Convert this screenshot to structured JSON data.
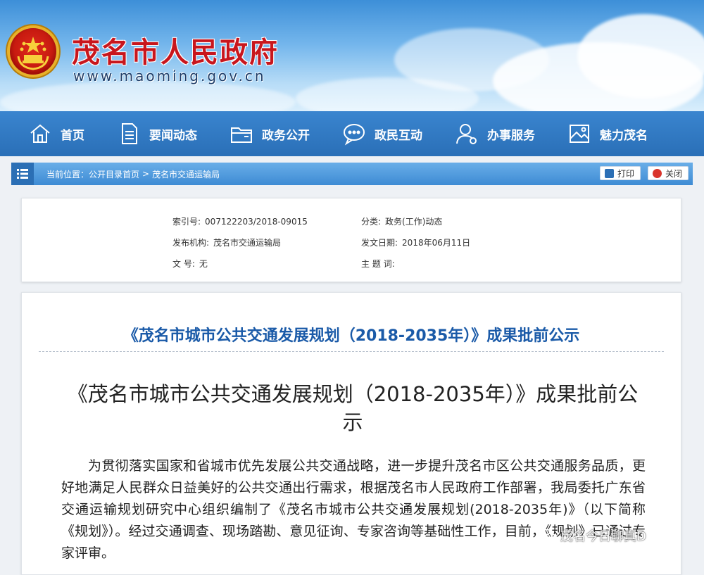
{
  "site": {
    "title": "茂名市人民政府",
    "url": "www.maoming.gov.cn"
  },
  "nav": {
    "items": [
      {
        "label": "首页",
        "icon": "home-icon"
      },
      {
        "label": "要闻动态",
        "icon": "document-icon"
      },
      {
        "label": "政务公开",
        "icon": "folder-icon"
      },
      {
        "label": "政民互动",
        "icon": "chat-icon"
      },
      {
        "label": "办事服务",
        "icon": "user-service-icon"
      },
      {
        "label": "魅力茂名",
        "icon": "landscape-icon"
      }
    ]
  },
  "location": {
    "label": "当前位置：",
    "crumbs": [
      "公开目录首页",
      "茂名市交通运输局"
    ],
    "separator": ">",
    "print_label": "打印",
    "close_label": "关闭"
  },
  "meta": {
    "index_label": "索引号:",
    "index_value": "007122203/2018-09015",
    "category_label": "分类:",
    "category_value": "政务(工作)动态",
    "publisher_label": "发布机构:",
    "publisher_value": "茂名市交通运输局",
    "date_label": "发文日期:",
    "date_value": "2018年06月11日",
    "docno_label": "文 号:",
    "docno_value": "无",
    "keywords_label": "主 题 词:",
    "keywords_value": ""
  },
  "article": {
    "title": "《茂名市城市公共交通发展规划（2018-2035年）》成果批前公示",
    "heading": "《茂名市城市公共交通发展规划（2018-2035年）》成果批前公示",
    "body": "为贯彻落实国家和省城市优先发展公共交通战略，进一步提升茂名市区公共交通服务品质，更好地满足人民群众日益美好的公共交通出行需求，根据茂名市人民政府工作部署，我局委托广东省交通运输规划研究中心组织编制了《茂名市城市公共交通发展规划(2018-2035年)》（以下简称《规划》）。经过交通调查、现场踏勘、意见征询、专家咨询等基础性工作，目前，《规划》已通过专家评审。"
  },
  "watermark": {
    "text": "茂名今日聊真D"
  },
  "colors": {
    "title_red": "#c8161d",
    "nav_blue": "#2a6fb7",
    "article_title_blue": "#1a5aa8"
  }
}
